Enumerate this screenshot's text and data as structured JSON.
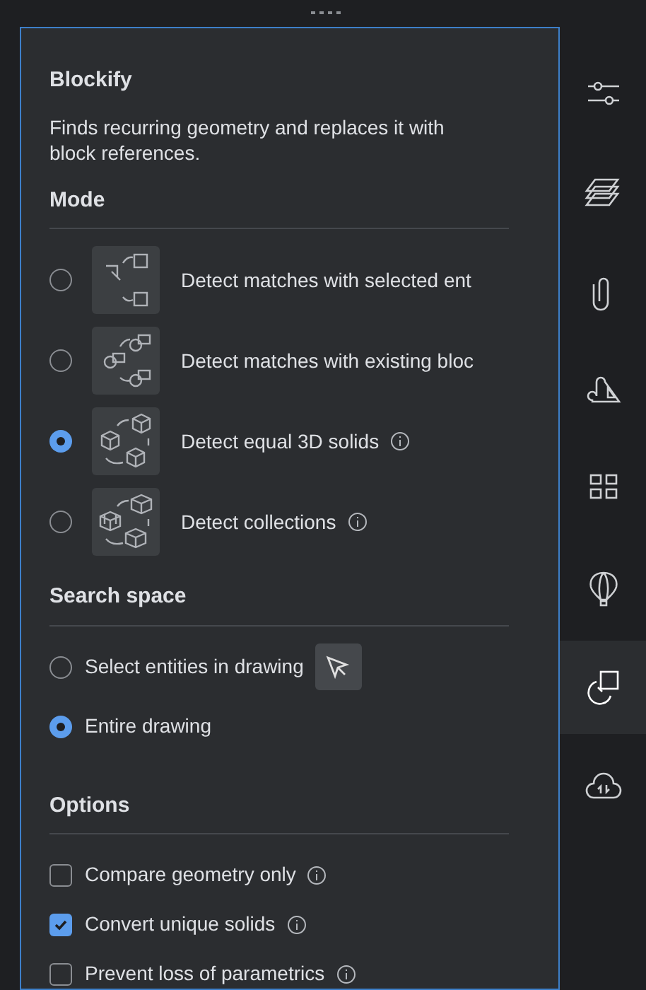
{
  "panel": {
    "title": "Blockify",
    "description": "Finds recurring geometry and replaces it with block references."
  },
  "mode": {
    "heading": "Mode",
    "options": [
      {
        "label": "Detect matches with selected ent",
        "selected": false,
        "info": false,
        "kind": "selected"
      },
      {
        "label": "Detect matches with existing bloc",
        "selected": false,
        "info": false,
        "kind": "existing"
      },
      {
        "label": "Detect equal 3D solids",
        "selected": true,
        "info": true,
        "kind": "solids"
      },
      {
        "label": "Detect collections",
        "selected": false,
        "info": true,
        "kind": "collections"
      }
    ]
  },
  "search_space": {
    "heading": "Search space",
    "options": [
      {
        "label": "Select entities in drawing",
        "selected": false,
        "pick_button": true
      },
      {
        "label": "Entire drawing",
        "selected": true,
        "pick_button": false
      }
    ]
  },
  "options": {
    "heading": "Options",
    "items": [
      {
        "label": "Compare geometry only",
        "checked": false
      },
      {
        "label": "Convert unique solids",
        "checked": true
      },
      {
        "label": "Prevent loss of parametrics",
        "checked": false
      }
    ]
  },
  "sidebar": {
    "items": [
      {
        "kind": "sliders",
        "selected": false
      },
      {
        "kind": "layers",
        "selected": false
      },
      {
        "kind": "clip",
        "selected": false
      },
      {
        "kind": "drawing",
        "selected": false
      },
      {
        "kind": "grid",
        "selected": false
      },
      {
        "kind": "balloon",
        "selected": false
      },
      {
        "kind": "blockify",
        "selected": true
      },
      {
        "kind": "cloud",
        "selected": false
      }
    ]
  }
}
